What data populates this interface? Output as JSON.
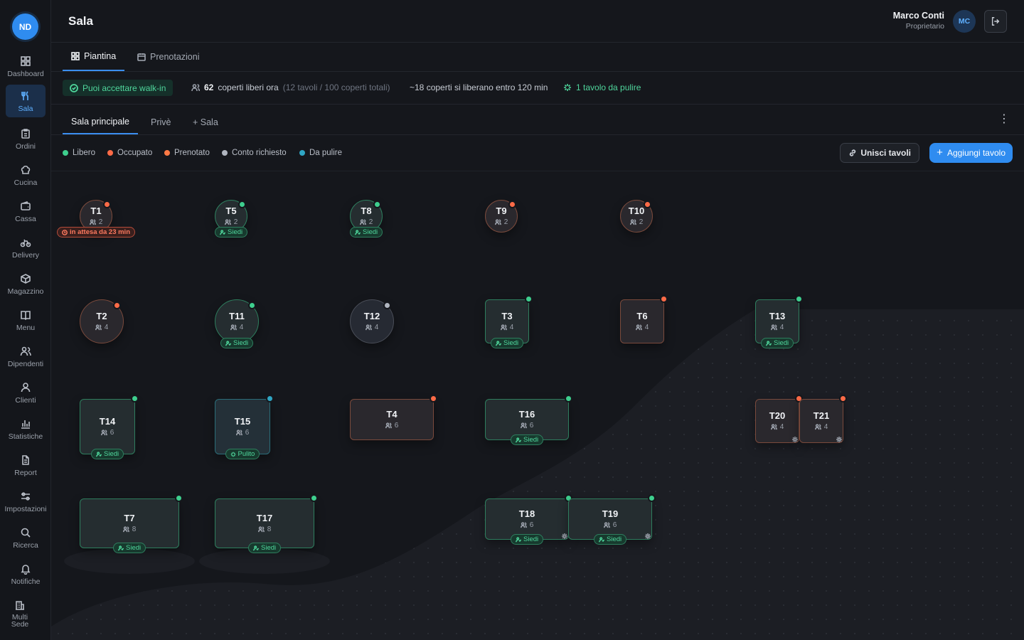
{
  "sidebar": {
    "avatar": "ND",
    "items": [
      {
        "label": "Dashboard",
        "icon": "grid-icon"
      },
      {
        "label": "Sala",
        "icon": "fork-knife-icon",
        "active": true
      },
      {
        "label": "Ordini",
        "icon": "clipboard-icon"
      },
      {
        "label": "Cucina",
        "icon": "chef-hat-icon"
      },
      {
        "label": "Cassa",
        "icon": "wallet-icon"
      },
      {
        "label": "Delivery",
        "icon": "bike-icon"
      },
      {
        "label": "Magazzino",
        "icon": "package-icon"
      },
      {
        "label": "Menu",
        "icon": "book-icon"
      },
      {
        "label": "Dipendenti",
        "icon": "users-icon"
      },
      {
        "label": "Clienti",
        "icon": "user-icon"
      },
      {
        "label": "Statistiche",
        "icon": "bar-chart-icon"
      },
      {
        "label": "Report",
        "icon": "file-icon"
      },
      {
        "label": "Impostazioni",
        "icon": "sliders-icon"
      },
      {
        "label": "Ricerca",
        "icon": "search-icon"
      },
      {
        "label": "Notifiche",
        "icon": "bell-icon"
      },
      {
        "label": "Multi Sede",
        "icon": "building-icon"
      }
    ]
  },
  "header": {
    "title": "Sala",
    "user_name": "Marco Conti",
    "user_role": "Proprietario",
    "user_initials": "MC"
  },
  "tabs": [
    {
      "label": "Piantina",
      "icon": "grid-icon",
      "active": true
    },
    {
      "label": "Prenotazioni",
      "icon": "calendar-icon"
    }
  ],
  "status": {
    "walkin": "Puoi accettare walk-in",
    "free_count": "62",
    "free_label": "coperti liberi ora",
    "free_detail": "(12 tavoli / 100 coperti totali)",
    "release": "~18 coperti si liberano entro 120 min",
    "clean": "1 tavolo da pulire"
  },
  "rooms": {
    "tabs": [
      "Sala principale",
      "Privè"
    ],
    "add_label": "+ Sala"
  },
  "legend": [
    {
      "label": "Libero",
      "color": "#3ecf8e"
    },
    {
      "label": "Occupato",
      "color": "#ff6b47"
    },
    {
      "label": "Prenotato",
      "color": "#ff7a45"
    },
    {
      "label": "Conto richiesto",
      "color": "#b0b5bf"
    },
    {
      "label": "Da pulire",
      "color": "#2fa6c4"
    }
  ],
  "actions": {
    "merge": "Unisci tavoli",
    "add": "Aggiungi tavolo"
  },
  "colors": {
    "free": "#3ecf8e",
    "busy": "#ff6b47",
    "bill": "#b0b5bf",
    "clean": "#2fa6c4",
    "accent": "#2f8cf0"
  },
  "tables": [
    {
      "name": "T1",
      "seats": "2",
      "status": "busy",
      "badge": "in attesa da 23 min",
      "badge_type": "red"
    },
    {
      "name": "T5",
      "seats": "2",
      "status": "free",
      "badge": "Siedi",
      "badge_type": "green"
    },
    {
      "name": "T8",
      "seats": "2",
      "status": "free",
      "badge": "Siedi",
      "badge_type": "green"
    },
    {
      "name": "T9",
      "seats": "2",
      "status": "busy"
    },
    {
      "name": "T10",
      "seats": "2",
      "status": "busy"
    },
    {
      "name": "T2",
      "seats": "4",
      "status": "busy"
    },
    {
      "name": "T11",
      "seats": "4",
      "status": "free",
      "badge": "Siedi",
      "badge_type": "green"
    },
    {
      "name": "T12",
      "seats": "4",
      "status": "bill"
    },
    {
      "name": "T3",
      "seats": "4",
      "status": "free",
      "badge": "Siedi",
      "badge_type": "green"
    },
    {
      "name": "T6",
      "seats": "4",
      "status": "busy"
    },
    {
      "name": "T13",
      "seats": "4",
      "status": "free",
      "badge": "Siedi",
      "badge_type": "green"
    },
    {
      "name": "T14",
      "seats": "6",
      "status": "free",
      "badge": "Siedi",
      "badge_type": "green"
    },
    {
      "name": "T15",
      "seats": "6",
      "status": "clean",
      "badge": "Pulito",
      "badge_type": "green"
    },
    {
      "name": "T4",
      "seats": "6",
      "status": "busy"
    },
    {
      "name": "T16",
      "seats": "6",
      "status": "free",
      "badge": "Siedi",
      "badge_type": "green"
    },
    {
      "name": "T20",
      "seats": "4",
      "status": "busy"
    },
    {
      "name": "T21",
      "seats": "4",
      "status": "busy"
    },
    {
      "name": "T7",
      "seats": "8",
      "status": "free",
      "badge": "Siedi",
      "badge_type": "green"
    },
    {
      "name": "T17",
      "seats": "8",
      "status": "free",
      "badge": "Siedi",
      "badge_type": "green"
    },
    {
      "name": "T18",
      "seats": "6",
      "status": "free",
      "badge": "Siedi",
      "badge_type": "green"
    },
    {
      "name": "T19",
      "seats": "6",
      "status": "free",
      "badge": "Siedi",
      "badge_type": "green"
    }
  ]
}
